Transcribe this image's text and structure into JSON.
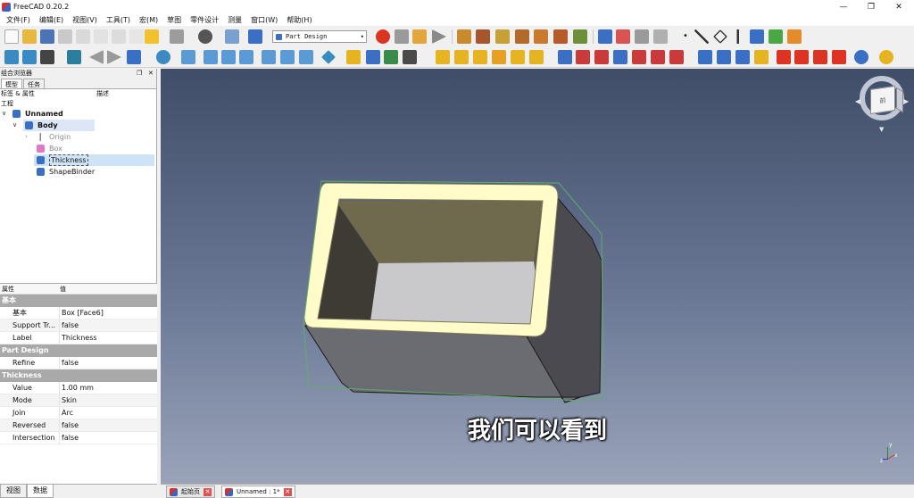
{
  "window": {
    "title": "FreeCAD 0.20.2",
    "minimize": "—",
    "maximize": "❐",
    "close": "✕"
  },
  "menu": [
    "文件(F)",
    "编辑(E)",
    "视图(V)",
    "工具(T)",
    "宏(M)",
    "草图",
    "零件设计",
    "测量",
    "窗口(W)",
    "帮助(H)"
  ],
  "toolbar": {
    "workbench": "Part Design"
  },
  "combo_view": {
    "title": "组合浏览器",
    "tabs": [
      "模型",
      "任务"
    ],
    "tree_headers": [
      "标签 & 属性",
      "描述"
    ],
    "section": "工程",
    "tree": [
      {
        "label": "Unnamed",
        "bold": true
      },
      {
        "label": "Body",
        "bold": true
      },
      {
        "label": "Origin"
      },
      {
        "label": "Box"
      },
      {
        "label": "Thickness"
      },
      {
        "label": "ShapeBinder"
      }
    ]
  },
  "properties": {
    "headers": [
      "属性",
      "值"
    ],
    "groups": [
      {
        "name": "基本",
        "rows": [
          [
            "基本",
            "Box [Face6]"
          ],
          [
            "Support Tr...",
            "false"
          ],
          [
            "Label",
            "Thickness"
          ]
        ]
      },
      {
        "name": "Part Design",
        "rows": [
          [
            "Refine",
            "false"
          ]
        ]
      },
      {
        "name": "Thickness",
        "rows": [
          [
            "Value",
            "1.00 mm"
          ],
          [
            "Mode",
            "Skin"
          ],
          [
            "Join",
            "Arc"
          ],
          [
            "Reversed",
            "false"
          ],
          [
            "Intersection",
            "false"
          ]
        ]
      }
    ]
  },
  "bottom_tabs": [
    "视图",
    "数据"
  ],
  "document_tabs": [
    {
      "label": "起始页"
    },
    {
      "label": "Unnamed : 1*"
    }
  ],
  "subtitle": "我们可以看到",
  "nav_cube": {
    "face": "前"
  },
  "axis": {
    "x": "x",
    "y": "y",
    "z": "z"
  }
}
